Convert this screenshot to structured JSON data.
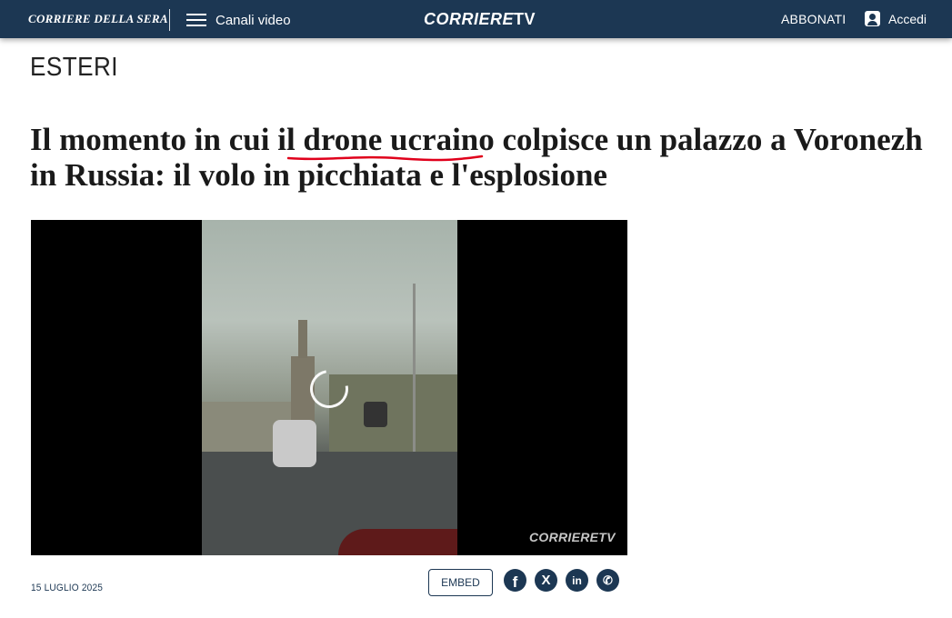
{
  "header": {
    "brand": "CORRIERE DELLA SERA",
    "menu_label": "Canali video",
    "logo": "CORRIERE",
    "logo_suffix": "TV",
    "subscribe_label": "ABBONATI",
    "login_label": "Accedi"
  },
  "article": {
    "section": "ESTERI",
    "title": "Il momento in cui il drone ucraino colpisce un palazzo a Voronezh in Russia: il volo in picchiata e l'esplosione",
    "date": "15 LUGLIO 2025"
  },
  "video": {
    "watermark": "CORRIERE",
    "watermark_suffix": "TV"
  },
  "actions": {
    "embed_label": "EMBED",
    "share": [
      {
        "name": "facebook-icon",
        "glyph": "f"
      },
      {
        "name": "x-icon",
        "glyph": "X"
      },
      {
        "name": "linkedin-icon",
        "glyph": "in"
      },
      {
        "name": "whatsapp-icon",
        "glyph": "✆"
      }
    ]
  },
  "colors": {
    "header_bg": "#1c3753",
    "accent": "#1c3753",
    "annotation_underline": "#e0001b"
  }
}
